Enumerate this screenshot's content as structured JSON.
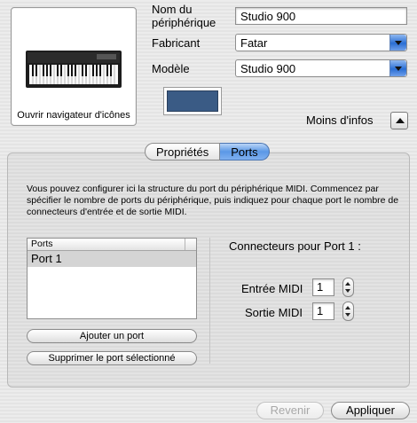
{
  "icon_browser": {
    "caption": "Ouvrir navigateur d'icônes"
  },
  "device": {
    "name_label": "Nom du\npériphérique",
    "name_value": "Studio 900",
    "manufacturer_label": "Fabricant",
    "manufacturer_value": "Fatar",
    "model_label": "Modèle",
    "model_value": "Studio 900"
  },
  "less_info_label": "Moins d'infos",
  "tabs": [
    {
      "label": "Propriétés",
      "selected": false
    },
    {
      "label": "Ports",
      "selected": true
    }
  ],
  "ports_panel": {
    "description": "Vous pouvez configurer ici la structure du port du périphérique MIDI. Commencez par spécifier le nombre de ports du périphérique, puis indiquez pour chaque port le nombre de connecteurs d'entrée et de sortie MIDI.",
    "list_header": "Ports",
    "list_items": [
      "Port 1"
    ],
    "add_port_label": "Ajouter un port",
    "remove_port_label": "Supprimer le port sélectionné",
    "connectors_title": "Connecteurs pour Port 1 :",
    "midi_in_label": "Entrée MIDI",
    "midi_in_value": "1",
    "midi_out_label": "Sortie MIDI",
    "midi_out_value": "1"
  },
  "footer": {
    "revert_label": "Revenir",
    "apply_label": "Appliquer"
  },
  "colors": {
    "accent": "#2a6ed4",
    "swatch": "#3a5b85"
  }
}
